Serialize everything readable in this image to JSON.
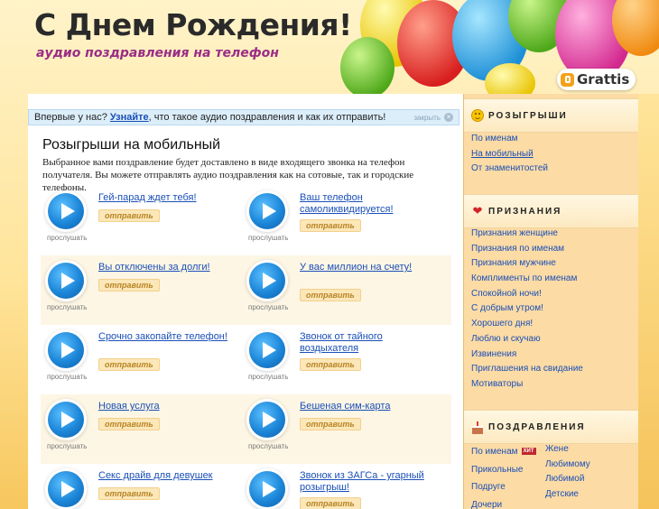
{
  "header": {
    "title": "С Днем Рождения!",
    "subtitle": "аудио поздравления на телефон",
    "logo_text": "Grattis"
  },
  "notice": {
    "prefix": "Впервые у нас? ",
    "link": "Узнайте",
    "suffix": ", что такое аудио поздравления и как их отправить!",
    "close": "закрыть"
  },
  "main": {
    "title": "Розыгрыши на мобильный",
    "description": "Выбранное вами поздравление будет доставлено в виде входящего звонка на телефон получателя. Вы можете отправлять аудио поздравления как на сотовые, так и городские телефоны.",
    "listen_label": "прослушать",
    "send_label": "отправить",
    "rows": [
      {
        "left": "Гей-парад ждет тебя!",
        "right": "Ваш телефон самоликвидируется!",
        "shaded": false
      },
      {
        "left": "Вы отключены за долги!",
        "right": "У вас миллион на счету!",
        "shaded": true
      },
      {
        "left": "Срочно закопайте телефон!",
        "right": "Звонок от тайного воздыхателя",
        "shaded": false
      },
      {
        "left": "Новая услуга",
        "right": "Бешеная сим-карта",
        "shaded": true
      },
      {
        "left": "Секс драйв для девушек",
        "right": "Звонок из ЗАГСа - угарный розыгрыш!",
        "shaded": false
      }
    ]
  },
  "sidebar": {
    "pranks": {
      "title": "РОЗЫГРЫШИ",
      "icon": "smile-icon",
      "items": [
        "По именам",
        "На мобильный",
        "От знаменитостей"
      ]
    },
    "confessions": {
      "title": "ПРИЗНАНИЯ",
      "icon": "heart-icon",
      "items": [
        "Признания женщине",
        "Признания по именам",
        "Признания мужчине",
        "Комплименты по именам",
        "Спокойной ночи!",
        "С добрым утром!",
        "Хорошего дня!",
        "Люблю и скучаю",
        "Извинения",
        "Приглашения на свидание",
        "Мотиваторы"
      ]
    },
    "greetings": {
      "title": "ПОЗДРАВЛЕНИЯ",
      "icon": "cake-icon",
      "badge": "ХИТ",
      "left": [
        "По именам",
        "Прикольные",
        "Подруге",
        "Дочери"
      ],
      "right": [
        "Жене",
        "Любимому",
        "Любимой",
        "Детские"
      ]
    }
  },
  "colors": {
    "link": "#1a4fb8",
    "subtitle": "#9a2d86",
    "sidebar_bg": "#fcdba4"
  }
}
